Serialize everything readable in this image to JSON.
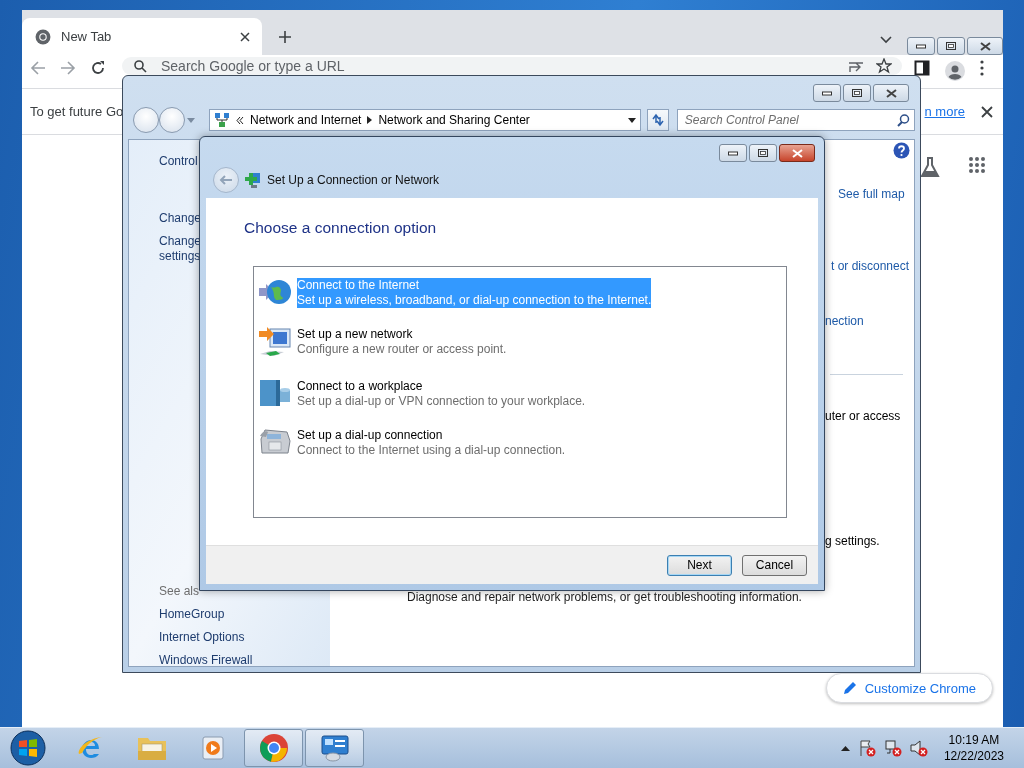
{
  "chrome": {
    "tab": {
      "title": "New Tab"
    },
    "omnibox": {
      "placeholder": "Search Google or type a URL"
    },
    "infobar": {
      "text": "To get future Go",
      "link": "n more"
    },
    "customize_button": "Customize Chrome"
  },
  "control_panel": {
    "breadcrumb": [
      "Network and Internet",
      "Network and Sharing Center"
    ],
    "search": {
      "placeholder": "Search Control Panel"
    },
    "sidebar": {
      "items": [
        "Control",
        "Change",
        "Change\nsettings"
      ],
      "see_also": {
        "heading": "See als",
        "links": [
          "HomeGroup",
          "Internet Options",
          "Windows Firewall"
        ]
      }
    },
    "content": {
      "fragments": [
        {
          "text": "See full map",
          "kind": "link"
        },
        {
          "text": "t or disconnect",
          "kind": "link"
        },
        {
          "text": "nection",
          "kind": "link"
        },
        {
          "text": "uter or access",
          "kind": "text",
          "divider_before": true
        },
        {
          "text": "g settings.",
          "kind": "text"
        }
      ],
      "diagnose": "Diagnose and repair network problems, or get troubleshooting information."
    }
  },
  "dialog": {
    "title": "Set Up a Connection or Network",
    "heading": "Choose a connection option",
    "options": [
      {
        "kind": "globe",
        "title": "Connect to the Internet",
        "description": "Set up a wireless, broadband, or dial-up connection to the Internet.",
        "selected": true
      },
      {
        "kind": "network",
        "title": "Set up a new network",
        "description": "Configure a new router or access point.",
        "selected": false
      },
      {
        "kind": "workplace",
        "title": "Connect to a workplace",
        "description": "Set up a dial-up or VPN connection to your workplace.",
        "selected": false
      },
      {
        "kind": "phone",
        "title": "Set up a dial-up connection",
        "description": "Connect to the Internet using a dial-up connection.",
        "selected": false
      }
    ],
    "buttons": [
      {
        "label": "Next",
        "default": true
      },
      {
        "label": "Cancel",
        "default": false
      }
    ]
  },
  "taskbar": {
    "apps": [
      {
        "kind": "ie",
        "active": false
      },
      {
        "kind": "explorer",
        "active": false
      },
      {
        "kind": "media",
        "active": false
      },
      {
        "kind": "chrome",
        "active": true
      },
      {
        "kind": "control-panel",
        "active": true
      }
    ],
    "clock": {
      "time": "10:19 AM",
      "date": "12/22/2023"
    }
  }
}
